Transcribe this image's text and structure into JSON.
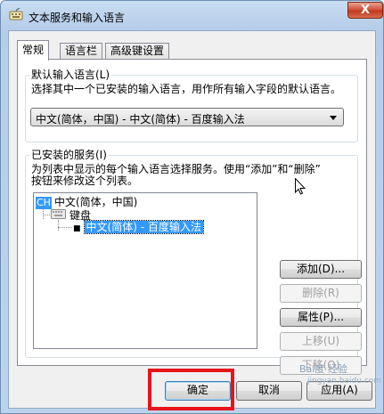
{
  "window": {
    "title": "文本服务和输入语言",
    "close_glyph": "X"
  },
  "tabs": [
    {
      "label": "常规",
      "active": true
    },
    {
      "label": "语言栏",
      "active": false
    },
    {
      "label": "高级键设置",
      "active": false
    }
  ],
  "default_language": {
    "group_label": "默认输入语言(L)",
    "description": "选择其中一个已安装的输入语言，用作所有输入字段的默认语言。",
    "selected_value": "中文(简体，中国) - 中文(简体) - 百度输入法"
  },
  "installed_services": {
    "group_label": "已安装的服务(I)",
    "description_line1": "为列表中显示的每个输入语言选择服务。使用“添加”和“删除”",
    "description_line2": "按钮来修改这个列表。",
    "tree": {
      "language_badge": "CH",
      "language": "中文(简体，中国)",
      "category": "键盘",
      "service": "中文(简体) - 百度输入法"
    },
    "buttons": {
      "add": "添加(D)...",
      "remove": "删除(R)",
      "properties": "属性(P)...",
      "move_up": "上移(U)",
      "move_down": "下移(O)"
    }
  },
  "footer": {
    "ok": "确定",
    "cancel": "取消",
    "apply": "应用(A)"
  },
  "overlay": {
    "highlight_color": "#e8141c",
    "watermark_text": "Bai度 经验",
    "watermark_sub": "jingyan.baidu.com"
  },
  "colors": {
    "selection": "#3399ff",
    "title_bg": "#bcd3ee"
  }
}
